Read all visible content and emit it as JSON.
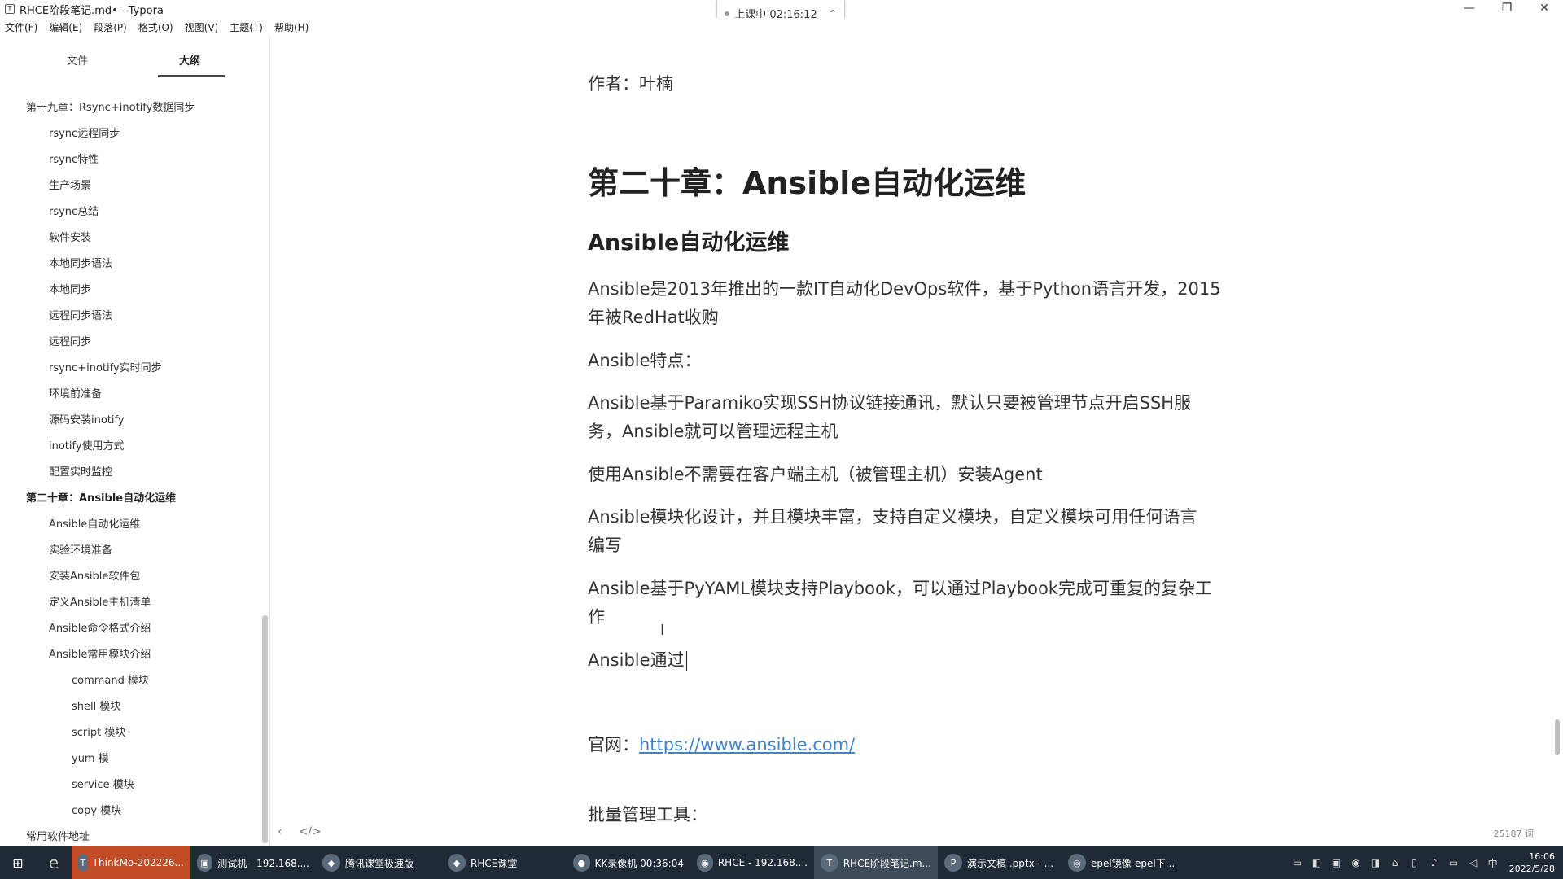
{
  "window": {
    "title": "RHCE阶段笔记.md• - Typora",
    "controls": [
      "—",
      "❐",
      "✕"
    ]
  },
  "recorder": {
    "status": "上课中 02:16:12"
  },
  "menu": [
    "文件(F)",
    "编辑(E)",
    "段落(P)",
    "格式(O)",
    "视图(V)",
    "主题(T)",
    "帮助(H)"
  ],
  "sidebar": {
    "tabs": [
      "文件",
      "大纲"
    ],
    "outline": [
      {
        "label": "第十九章：Rsync+inotify数据同步",
        "level": 1
      },
      {
        "label": "rsync远程同步",
        "level": 2
      },
      {
        "label": "rsync特性",
        "level": 2
      },
      {
        "label": "生产场景",
        "level": 2
      },
      {
        "label": "rsync总结",
        "level": 2
      },
      {
        "label": "软件安装",
        "level": 2
      },
      {
        "label": "本地同步语法",
        "level": 2
      },
      {
        "label": "本地同步",
        "level": 2
      },
      {
        "label": "远程同步语法",
        "level": 2
      },
      {
        "label": "远程同步",
        "level": 2
      },
      {
        "label": "rsync+inotify实时同步",
        "level": 2
      },
      {
        "label": "环境前准备",
        "level": 2
      },
      {
        "label": "源码安装inotify",
        "level": 2
      },
      {
        "label": "inotify使用方式",
        "level": 2
      },
      {
        "label": "配置实时监控",
        "level": 2
      },
      {
        "label": "第二十章：Ansible自动化运维",
        "level": 1,
        "active": true
      },
      {
        "label": "Ansible自动化运维",
        "level": 2
      },
      {
        "label": "实验环境准备",
        "level": 2
      },
      {
        "label": "安装Ansible软件包",
        "level": 2
      },
      {
        "label": "定义Ansible主机清单",
        "level": 2
      },
      {
        "label": "Ansible命令格式介绍",
        "level": 2
      },
      {
        "label": "Ansible常用模块介绍",
        "level": 2
      },
      {
        "label": "command 模块",
        "level": 3
      },
      {
        "label": "shell 模块",
        "level": 3
      },
      {
        "label": "script 模块",
        "level": 3
      },
      {
        "label": "yum 模",
        "level": 3
      },
      {
        "label": "service 模块",
        "level": 3
      },
      {
        "label": "copy 模块",
        "level": 3
      },
      {
        "label": "常用软件地址",
        "level": 1
      }
    ]
  },
  "document": {
    "author": "作者：叶楠",
    "h1": "第二十章：Ansible自动化运维",
    "h2": "Ansible自动化运维",
    "para1_line1": "Ansible是2013年推出的一款IT自动化DevOps软件，基于Python语言开发，2015",
    "para1_line2": "年被RedHat收购",
    "features_title": "Ansible特点：",
    "para2_line1": "Ansible基于Paramiko实现SSH协议链接通讯，默认只要被管理节点开启SSH服",
    "para2_line2": "务，Ansible就可以管理远程主机",
    "para3": "使用Ansible不需要在客户端主机（被管理主机）安装Agent",
    "para4_line1": "Ansible模块化设计，并且模块丰富，支持自定义模块，自定义模块可用任何语言",
    "para4_line2": "编写",
    "para5_line1": "Ansible基于PyYAML模块支持Playbook，可以通过Playbook完成可重复的复杂工",
    "para5_line2": "作",
    "para6": "Ansible通过",
    "site_label": "官网：",
    "site_url": "https://www.ansible.com/",
    "batch_title": "批量管理工具：",
    "word_count": "25187 词"
  },
  "taskbar": {
    "items": [
      {
        "label": "ThinkMo-202226...",
        "icon": "T"
      },
      {
        "label": "测试机 - 192.168....",
        "icon": "▣"
      },
      {
        "label": "腾讯课堂极速版",
        "icon": "◆"
      },
      {
        "label": "RHCE课堂",
        "icon": "◆"
      },
      {
        "label": "KK录像机 00:36:04",
        "icon": "●"
      },
      {
        "label": "RHCE - 192.168....",
        "icon": "◉"
      },
      {
        "label": "RHCE阶段笔记.m...",
        "icon": "T"
      },
      {
        "label": "演示文稿 .pptx - ...",
        "icon": "P"
      },
      {
        "label": "epel镜像-epel下...",
        "icon": "◎"
      }
    ],
    "ime": "中",
    "time": "16:06",
    "date": "2022/5/28"
  },
  "colors": {
    "taskbar_bg": "#1f2a36",
    "link": "#4183c4",
    "accent_task": "#c14c26"
  }
}
